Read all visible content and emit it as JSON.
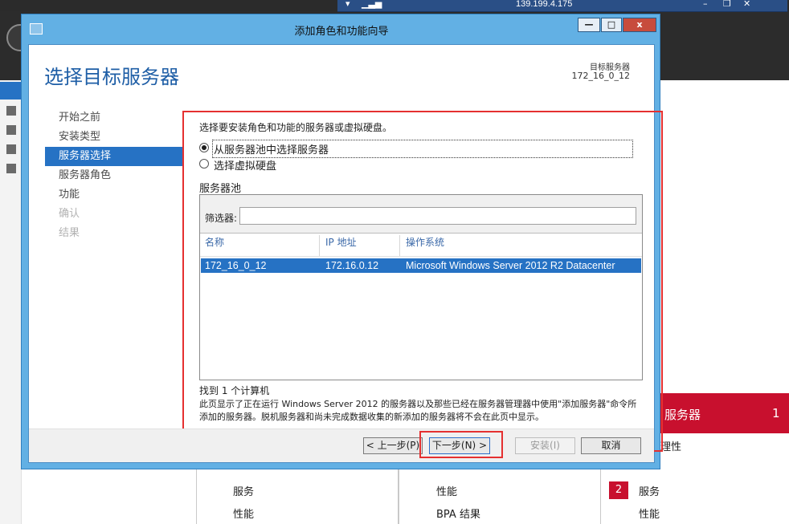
{
  "rdp": {
    "ip": "139.199.4.175"
  },
  "background": {
    "band_title": "服务器",
    "band_count": "1",
    "badge": "2",
    "items": [
      "理性",
      "服务",
      "性能",
      "性能",
      "BPA 结果",
      "服务",
      "性能"
    ]
  },
  "window": {
    "title": "添加角色和功能向导",
    "minimize": "—",
    "maximize": "□",
    "close": "x"
  },
  "page": {
    "title": "选择目标服务器",
    "dest_label": "目标服务器",
    "dest_value": "172_16_0_12"
  },
  "steps": [
    {
      "label": "开始之前",
      "state": "normal"
    },
    {
      "label": "安装类型",
      "state": "normal"
    },
    {
      "label": "服务器选择",
      "state": "current"
    },
    {
      "label": "服务器角色",
      "state": "normal"
    },
    {
      "label": "功能",
      "state": "normal"
    },
    {
      "label": "确认",
      "state": "disabled"
    },
    {
      "label": "结果",
      "state": "disabled"
    }
  ],
  "content": {
    "description": "选择要安装角色和功能的服务器或虚拟硬盘。",
    "radio_pool": "从服务器池中选择服务器",
    "radio_vhd": "选择虚拟硬盘",
    "pool_title": "服务器池",
    "filter_label": "筛选器:",
    "filter_value": "",
    "columns": {
      "name": "名称",
      "ip": "IP 地址",
      "os": "操作系统"
    },
    "rows": [
      {
        "name": "172_16_0_12",
        "ip": "172.16.0.12",
        "os": "Microsoft Windows Server 2012 R2 Datacenter"
      }
    ],
    "count": "找到 1 个计算机",
    "note": "此页显示了正在运行 Windows Server 2012 的服务器以及那些已经在服务器管理器中使用\"添加服务器\"命令所添加的服务器。脱机服务器和尚未完成数据收集的新添加的服务器将不会在此页中显示。"
  },
  "buttons": {
    "prev": "< 上一步(P)",
    "next": "下一步(N) >",
    "install": "安装(I)",
    "cancel": "取消"
  },
  "colors": {
    "accent": "#2672c4",
    "title_bar": "#62b0e4",
    "highlight": "#e53030",
    "band": "#c8102e"
  }
}
